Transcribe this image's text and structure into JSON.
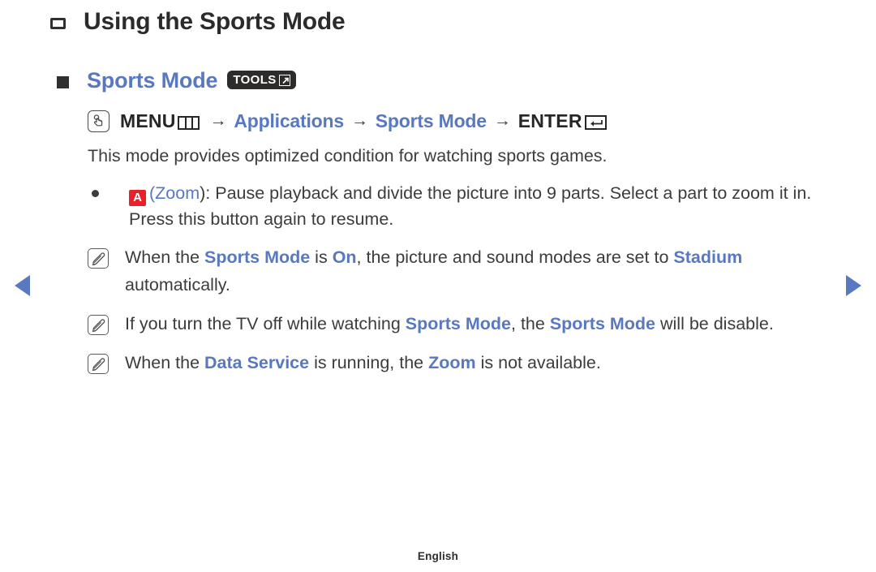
{
  "page": {
    "title": "Using the Sports Mode",
    "footer_language": "English"
  },
  "nav": {
    "prev_label": "Previous page",
    "next_label": "Next page"
  },
  "section": {
    "heading": "Sports Mode",
    "tools_badge_label": "TOOLS",
    "tools_badge_icon": "popup-window-arrow-icon",
    "bullet_icon": "filled-square-bullet"
  },
  "menu_path": {
    "icon": "touch-button-icon",
    "menu_label": "MENU",
    "menu_box_icon": "menu-grid-icon",
    "arrow": "→",
    "step2": "Applications",
    "step3": "Sports Mode",
    "enter_label": "ENTER",
    "enter_box_icon": "enter-return-icon"
  },
  "description": "This mode provides optimized condition for watching sports games.",
  "zoom_bullet": {
    "badge": "A",
    "badge_color": "#e8202a",
    "open_paren": "(",
    "link_text": "Zoom",
    "close_paren": "): ",
    "text": "Pause playback and divide the picture into 9 parts. Select a part to zoom it in. Press this button again to resume."
  },
  "notes": [
    {
      "icon": "note-pencil-icon",
      "parts": [
        {
          "t": "When the ",
          "style": "plain"
        },
        {
          "t": "Sports Mode",
          "style": "blue-bold"
        },
        {
          "t": " is ",
          "style": "plain"
        },
        {
          "t": "On",
          "style": "blue-bold"
        },
        {
          "t": ", the picture and sound modes are set to ",
          "style": "plain"
        },
        {
          "t": "Stadium",
          "style": "blue-bold"
        },
        {
          "t": " automatically.",
          "style": "plain"
        }
      ]
    },
    {
      "icon": "note-pencil-icon",
      "parts": [
        {
          "t": "If you turn the TV off while watching ",
          "style": "plain"
        },
        {
          "t": "Sports Mode",
          "style": "blue-bold"
        },
        {
          "t": ", the ",
          "style": "plain"
        },
        {
          "t": "Sports Mode",
          "style": "blue-bold"
        },
        {
          "t": " will be disable.",
          "style": "plain"
        }
      ]
    },
    {
      "icon": "note-pencil-icon",
      "parts": [
        {
          "t": "When the ",
          "style": "plain"
        },
        {
          "t": "Data Service",
          "style": "blue-bold"
        },
        {
          "t": " is running, the ",
          "style": "plain"
        },
        {
          "t": "Zoom",
          "style": "blue-bold"
        },
        {
          "t": " is not available.",
          "style": "plain"
        }
      ]
    }
  ],
  "colors": {
    "accent_blue": "#5878c0",
    "text": "#3c3c3c",
    "badge_red": "#e8202a",
    "badge_dark": "#2e2b2b"
  }
}
